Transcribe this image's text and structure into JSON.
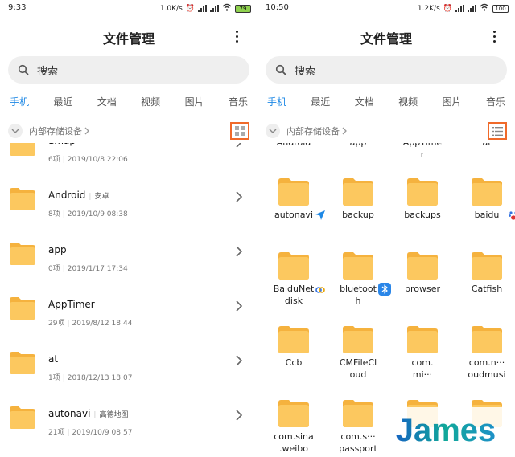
{
  "left": {
    "status": {
      "time": "9:33",
      "speed": "1.0K/s",
      "battery": "79"
    },
    "title": "文件管理",
    "search_placeholder": "搜索",
    "tabs": [
      "手机",
      "最近",
      "文档",
      "视频",
      "图片",
      "音乐"
    ],
    "path": "内部存储设备",
    "rows": [
      {
        "name": "amap",
        "count": "6项",
        "date": "2019/10/8 22:06",
        "tag": ""
      },
      {
        "name": "Android",
        "count": "8项",
        "date": "2019/10/9 08:38",
        "tag": "安卓"
      },
      {
        "name": "app",
        "count": "0项",
        "date": "2019/1/17 17:34",
        "tag": ""
      },
      {
        "name": "AppTimer",
        "count": "29项",
        "date": "2019/8/12 18:44",
        "tag": ""
      },
      {
        "name": "at",
        "count": "1项",
        "date": "2018/12/13 18:07",
        "tag": ""
      },
      {
        "name": "autonavi",
        "count": "21项",
        "date": "2019/10/9 08:57",
        "tag": "高德地图"
      }
    ]
  },
  "right": {
    "status": {
      "time": "10:50",
      "speed": "1.2K/s",
      "battery": "100"
    },
    "title": "文件管理",
    "search_placeholder": "搜索",
    "tabs": [
      "手机",
      "最近",
      "文档",
      "视频",
      "图片",
      "音乐"
    ],
    "path": "内部存储设备",
    "top_partial": [
      "Android",
      "app",
      "AppTime\nr",
      "at"
    ],
    "grid": [
      {
        "label": "autonavi",
        "badge": "autonavi"
      },
      {
        "label": "backup",
        "badge": ""
      },
      {
        "label": "backups",
        "badge": ""
      },
      {
        "label": "baidu",
        "badge": "baidu"
      },
      {
        "label": "BaiduNet\ndisk",
        "badge": "baidunetdisk"
      },
      {
        "label": "bluetoot\nh",
        "badge": "bluetooth"
      },
      {
        "label": "browser",
        "badge": ""
      },
      {
        "label": "Catfish",
        "badge": ""
      },
      {
        "label": "Ccb",
        "badge": ""
      },
      {
        "label": "CMFileCl\noud",
        "badge": ""
      },
      {
        "label": "com.\nmi···",
        "badge": ""
      },
      {
        "label": "com.n···\noudmusi",
        "badge": ""
      },
      {
        "label": "com.sina\n.weibo",
        "badge": ""
      },
      {
        "label": "com.s···\npassport",
        "badge": ""
      },
      {
        "label": "",
        "badge": ""
      },
      {
        "label": "",
        "badge": ""
      }
    ]
  },
  "colors": {
    "folder": "#fcc85f",
    "folder_tab": "#f5b23e",
    "accent": "#1e88e5",
    "highlight": "#f06a2a"
  },
  "watermark": "James"
}
